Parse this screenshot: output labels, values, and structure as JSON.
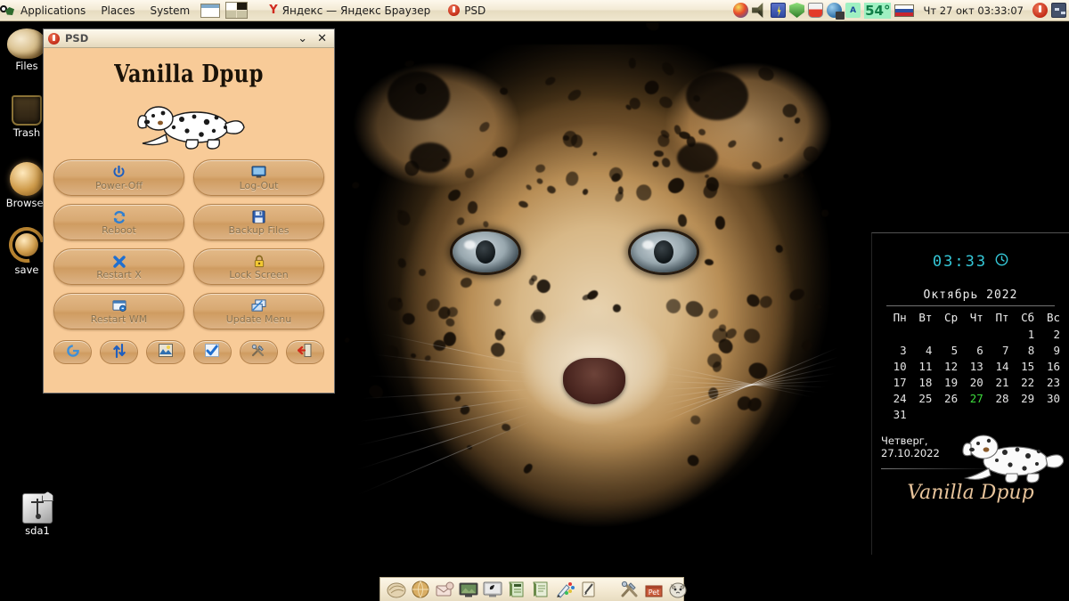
{
  "top_panel": {
    "logo_icon": "puppy-logo-icon",
    "menus": [
      {
        "label": "Applications",
        "name": "menu-applications"
      },
      {
        "label": "Places",
        "name": "menu-places"
      },
      {
        "label": "System",
        "name": "menu-system"
      }
    ],
    "pager": {
      "name": "workspace-pager",
      "workspaces": 2,
      "active": 1
    },
    "tasks": [
      {
        "label": "Яндекс — Яндекс Браузер",
        "icon": "yandex-browser-icon",
        "name": "task-yandex-browser"
      },
      {
        "label": "PSD",
        "icon": "psd-icon",
        "name": "task-psd"
      }
    ],
    "tray": [
      {
        "name": "tray-palette-icon",
        "icon": "palette-icon"
      },
      {
        "name": "tray-volume-icon",
        "icon": "speaker-icon"
      },
      {
        "name": "tray-battery-icon",
        "icon": "battery-icon"
      },
      {
        "name": "tray-firewall-icon",
        "icon": "shield-icon"
      },
      {
        "name": "tray-diskfree-icon",
        "icon": "beaker-icon"
      },
      {
        "name": "tray-network-icon",
        "icon": "network-icon"
      },
      {
        "name": "tray-keyboard-layout",
        "icon": "keyboard-icon",
        "label": "А"
      }
    ],
    "temperature": "54°",
    "flag": "ru-flag-icon",
    "clock": "Чт 27 окт 03:33:07",
    "power_icon": "power-icon",
    "show_desktop_icon": "show-desktop-icon"
  },
  "desktop_icons": [
    {
      "label": "Files",
      "icon": "shell-files-icon",
      "name": "desktop-icon-files"
    },
    {
      "label": "Trash",
      "icon": "trash-icon",
      "name": "desktop-icon-trash"
    },
    {
      "label": "Browser",
      "icon": "globe-browser-icon",
      "name": "desktop-icon-browser"
    },
    {
      "label": "save",
      "icon": "save-session-icon",
      "name": "desktop-icon-save"
    },
    {
      "label": "sda1",
      "icon": "usb-drive-icon",
      "name": "desktop-icon-sda1"
    }
  ],
  "psd_window": {
    "title": "PSD",
    "title_icon": "psd-icon",
    "minimize_label": "⌄",
    "close_label": "✕",
    "brand": "Vanilla Dpup",
    "logo_icon": "dalmatian-puppy-icon",
    "buttons": [
      {
        "label": "Power-Off",
        "icon": "power-icon",
        "name": "power-off-button"
      },
      {
        "label": "Log-Out",
        "icon": "logout-monitor-icon",
        "name": "log-out-button"
      },
      {
        "label": "Reboot",
        "icon": "reboot-refresh-icon",
        "name": "reboot-button"
      },
      {
        "label": "Backup Files",
        "icon": "floppy-save-icon",
        "name": "backup-files-button"
      },
      {
        "label": "Restart X",
        "icon": "x-cross-icon",
        "name": "restart-x-button"
      },
      {
        "label": "Lock Screen",
        "icon": "lock-icon",
        "name": "lock-screen-button"
      },
      {
        "label": "Restart WM",
        "icon": "window-restart-icon",
        "name": "restart-wm-button"
      },
      {
        "label": "Update Menu",
        "icon": "menu-update-icon",
        "name": "update-menu-button"
      }
    ],
    "small_buttons": [
      {
        "icon": "refresh-circle-icon",
        "name": "refresh-button"
      },
      {
        "icon": "updown-arrows-icon",
        "name": "swap-button"
      },
      {
        "icon": "image-picture-icon",
        "name": "wallpaper-button"
      },
      {
        "icon": "blue-check-icon",
        "name": "apply-button"
      },
      {
        "icon": "tools-icon",
        "name": "tools-button"
      },
      {
        "icon": "exit-door-icon",
        "name": "exit-button"
      }
    ]
  },
  "conky": {
    "time": "03:33",
    "clock_icon": "clock-icon",
    "month_year": "Октябрь 2022",
    "weekday_headers": [
      "Пн",
      "Вт",
      "Ср",
      "Чт",
      "Пт",
      "Сб",
      "Вс"
    ],
    "weeks": [
      [
        "",
        "",
        "",
        "",
        "",
        "1",
        "2"
      ],
      [
        "3",
        "4",
        "5",
        "6",
        "7",
        "8",
        "9"
      ],
      [
        "10",
        "11",
        "12",
        "13",
        "14",
        "15",
        "16"
      ],
      [
        "17",
        "18",
        "19",
        "20",
        "21",
        "22",
        "23"
      ],
      [
        "24",
        "25",
        "26",
        "27",
        "28",
        "29",
        "30"
      ],
      [
        "31",
        "",
        "",
        "",
        "",
        "",
        ""
      ]
    ],
    "today": "27",
    "day_name": "Четверг,",
    "date": "27.10.2022",
    "brand": "Vanilla Dpup",
    "dog_icon": "dalmatian-puppy-icon"
  },
  "dock": {
    "items": [
      {
        "icon": "shell-files-icon",
        "name": "dock-files"
      },
      {
        "icon": "globe-browser-icon",
        "name": "dock-browser"
      },
      {
        "icon": "mail-icon",
        "name": "dock-mail"
      },
      {
        "icon": "media-player-icon",
        "name": "dock-media"
      },
      {
        "icon": "monitor-icon",
        "name": "dock-monitor"
      },
      {
        "icon": "text-editor-icon",
        "name": "dock-editor"
      },
      {
        "icon": "document-icon",
        "name": "dock-document"
      },
      {
        "icon": "paint-palette-icon",
        "name": "dock-paint"
      },
      {
        "icon": "notepad-pen-icon",
        "name": "dock-notepad"
      },
      {
        "icon": "tools-icon",
        "name": "dock-tools"
      },
      {
        "icon": "pet-box-icon",
        "name": "dock-petget"
      },
      {
        "icon": "cat-icon",
        "name": "dock-cat"
      }
    ]
  },
  "colors": {
    "panel_bg": "#f3ead5",
    "window_bg": "#f8cb98",
    "button_bg": "#d8a973",
    "accent_cyan": "#35c8d8",
    "today_green": "#3ddc3d",
    "brand_peach": "#e8c49b"
  }
}
